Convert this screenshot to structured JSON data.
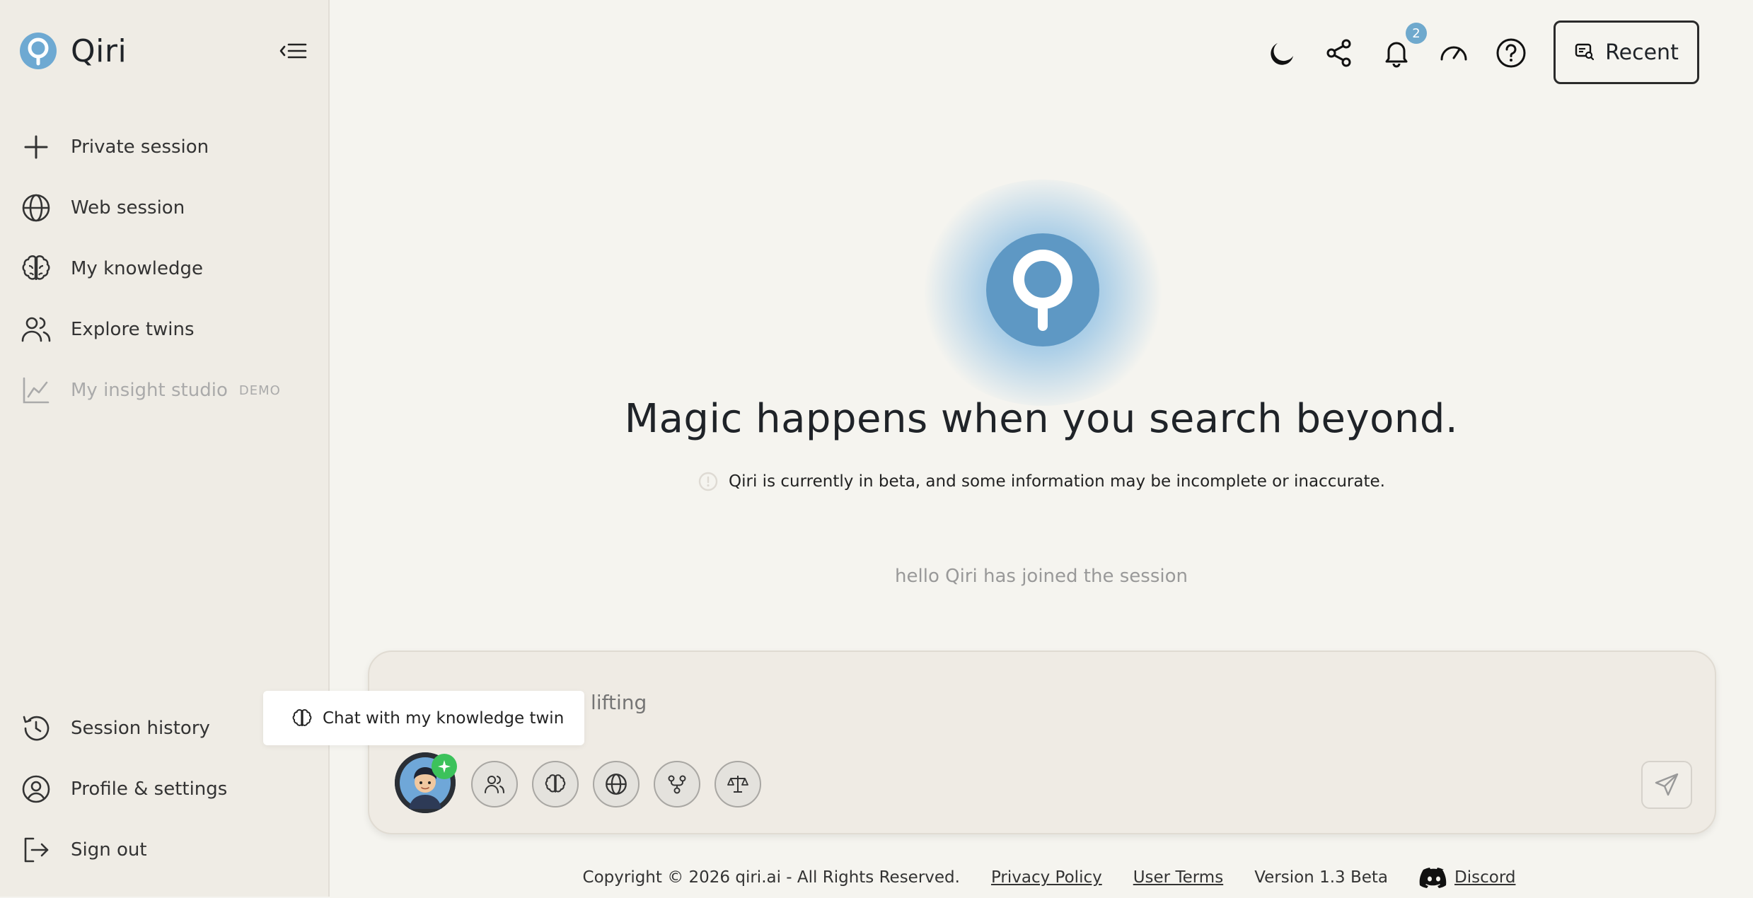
{
  "brand": {
    "name": "Qiri"
  },
  "sidebar": {
    "items": [
      {
        "label": "Private session",
        "icon": "plus-icon"
      },
      {
        "label": "Web session",
        "icon": "globe-icon"
      },
      {
        "label": "My knowledge",
        "icon": "brain-icon"
      },
      {
        "label": "Explore twins",
        "icon": "users-icon"
      },
      {
        "label": "My insight studio",
        "tag": "DEMO",
        "icon": "chart-line-icon",
        "disabled": true
      }
    ],
    "bottom": [
      {
        "label": "Session history",
        "icon": "history-icon"
      },
      {
        "label": "Profile & settings",
        "icon": "user-circle-icon"
      },
      {
        "label": "Sign out",
        "icon": "sign-out-icon"
      }
    ]
  },
  "topbar": {
    "notifications_count": "2",
    "recent_label": "Recent"
  },
  "main": {
    "headline": "Magic happens when you search beyond.",
    "beta_note": "Qiri is currently in beta, and some information may be incomplete or inaccurate.",
    "join_message": "hello Qiri has joined the session"
  },
  "composer": {
    "placeholder": ", I'll do the heavy lifting",
    "tooltip": "Chat with my knowledge twin"
  },
  "footer": {
    "copyright": "Copyright © 2026 qiri.ai - All Rights Reserved.",
    "privacy": "Privacy Policy",
    "terms": "User Terms",
    "version": "Version 1.3 Beta",
    "discord": "Discord"
  },
  "colors": {
    "accent": "#5e98c4",
    "badge": "#6fa9cd",
    "sidebar_bg": "#efece5",
    "page_bg": "#f5f4ef",
    "online": "#3cc25b"
  }
}
